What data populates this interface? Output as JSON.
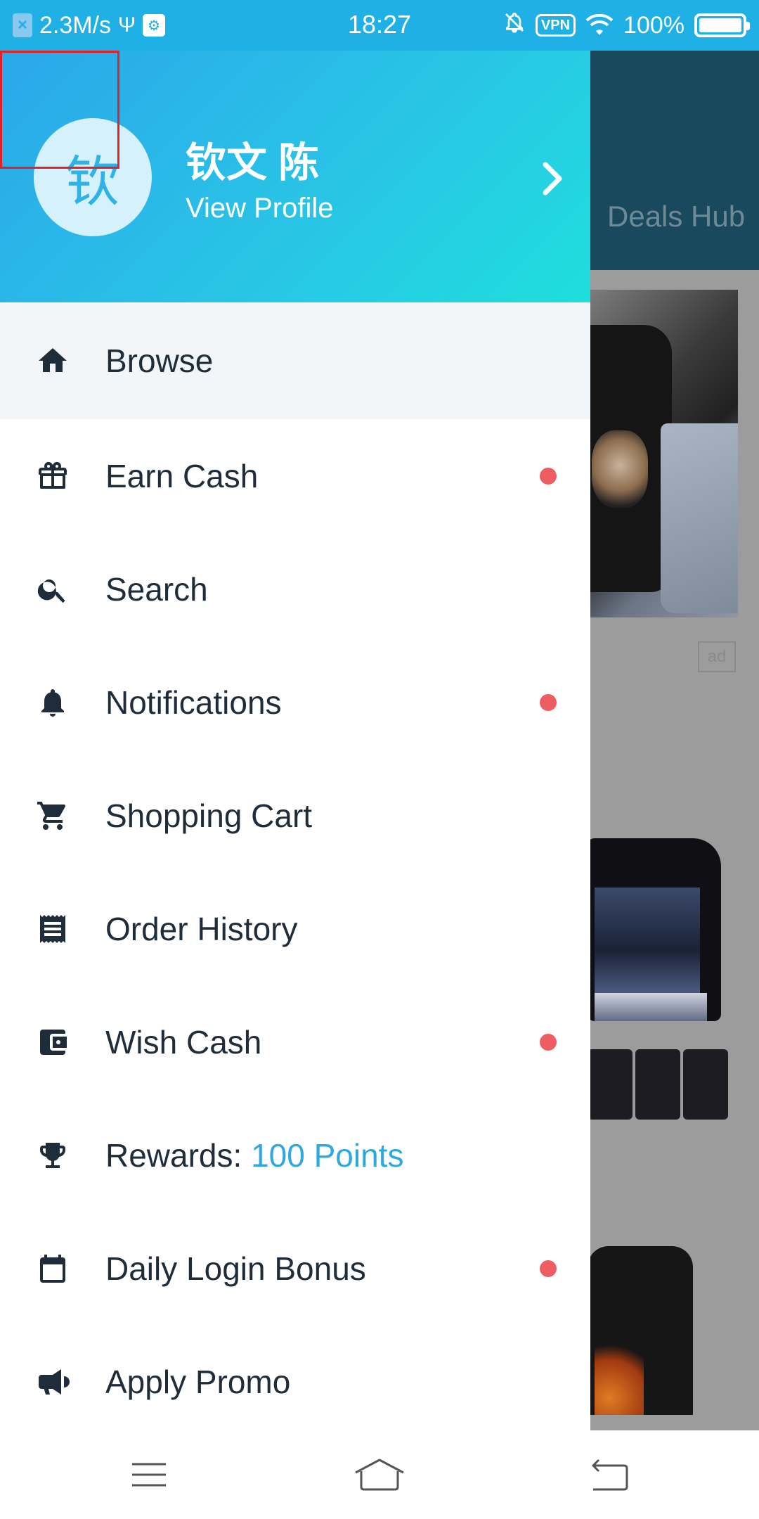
{
  "status_bar": {
    "speed": "2.3M/s",
    "time": "18:27",
    "vpn": "VPN",
    "battery": "100%",
    "icons": [
      "x-notification-icon",
      "usb-icon",
      "usb-debug-icon",
      "bell-off-icon",
      "vpn-icon",
      "wifi-icon",
      "battery-icon"
    ]
  },
  "background": {
    "deals_tab": "Deals Hub",
    "ad_label": "ad"
  },
  "profile": {
    "avatar_initial": "钦",
    "name": "钦文 陈",
    "subtitle": "View Profile"
  },
  "menu": {
    "items": [
      {
        "label": "Browse",
        "icon": "home-icon",
        "active": true,
        "dot": false
      },
      {
        "label": "Earn Cash",
        "icon": "gift-icon",
        "dot": true
      },
      {
        "label": "Search",
        "icon": "search-icon",
        "dot": false
      },
      {
        "label": "Notifications",
        "icon": "bell-icon",
        "dot": true
      },
      {
        "label": "Shopping Cart",
        "icon": "cart-icon",
        "dot": false
      },
      {
        "label": "Order History",
        "icon": "receipt-icon",
        "dot": false
      },
      {
        "label": "Wish Cash",
        "icon": "wallet-icon",
        "dot": true
      },
      {
        "label": "Rewards: ",
        "accent": "100 Points",
        "icon": "trophy-icon",
        "dot": false
      },
      {
        "label": "Daily Login Bonus",
        "icon": "calendar-icon",
        "dot": true
      },
      {
        "label": "Apply Promo",
        "icon": "megaphone-icon",
        "dot": false
      }
    ]
  },
  "colors": {
    "status_bar": "#1fb1e6",
    "header_gradient_start": "#2aa7ea",
    "header_gradient_end": "#1fdedd",
    "accent": "#2fa8df",
    "dot": "#ee5d62",
    "text": "#1f2d3a"
  },
  "nav_bar": {
    "icons": [
      "menu-icon",
      "home-outline-icon",
      "back-icon"
    ]
  }
}
